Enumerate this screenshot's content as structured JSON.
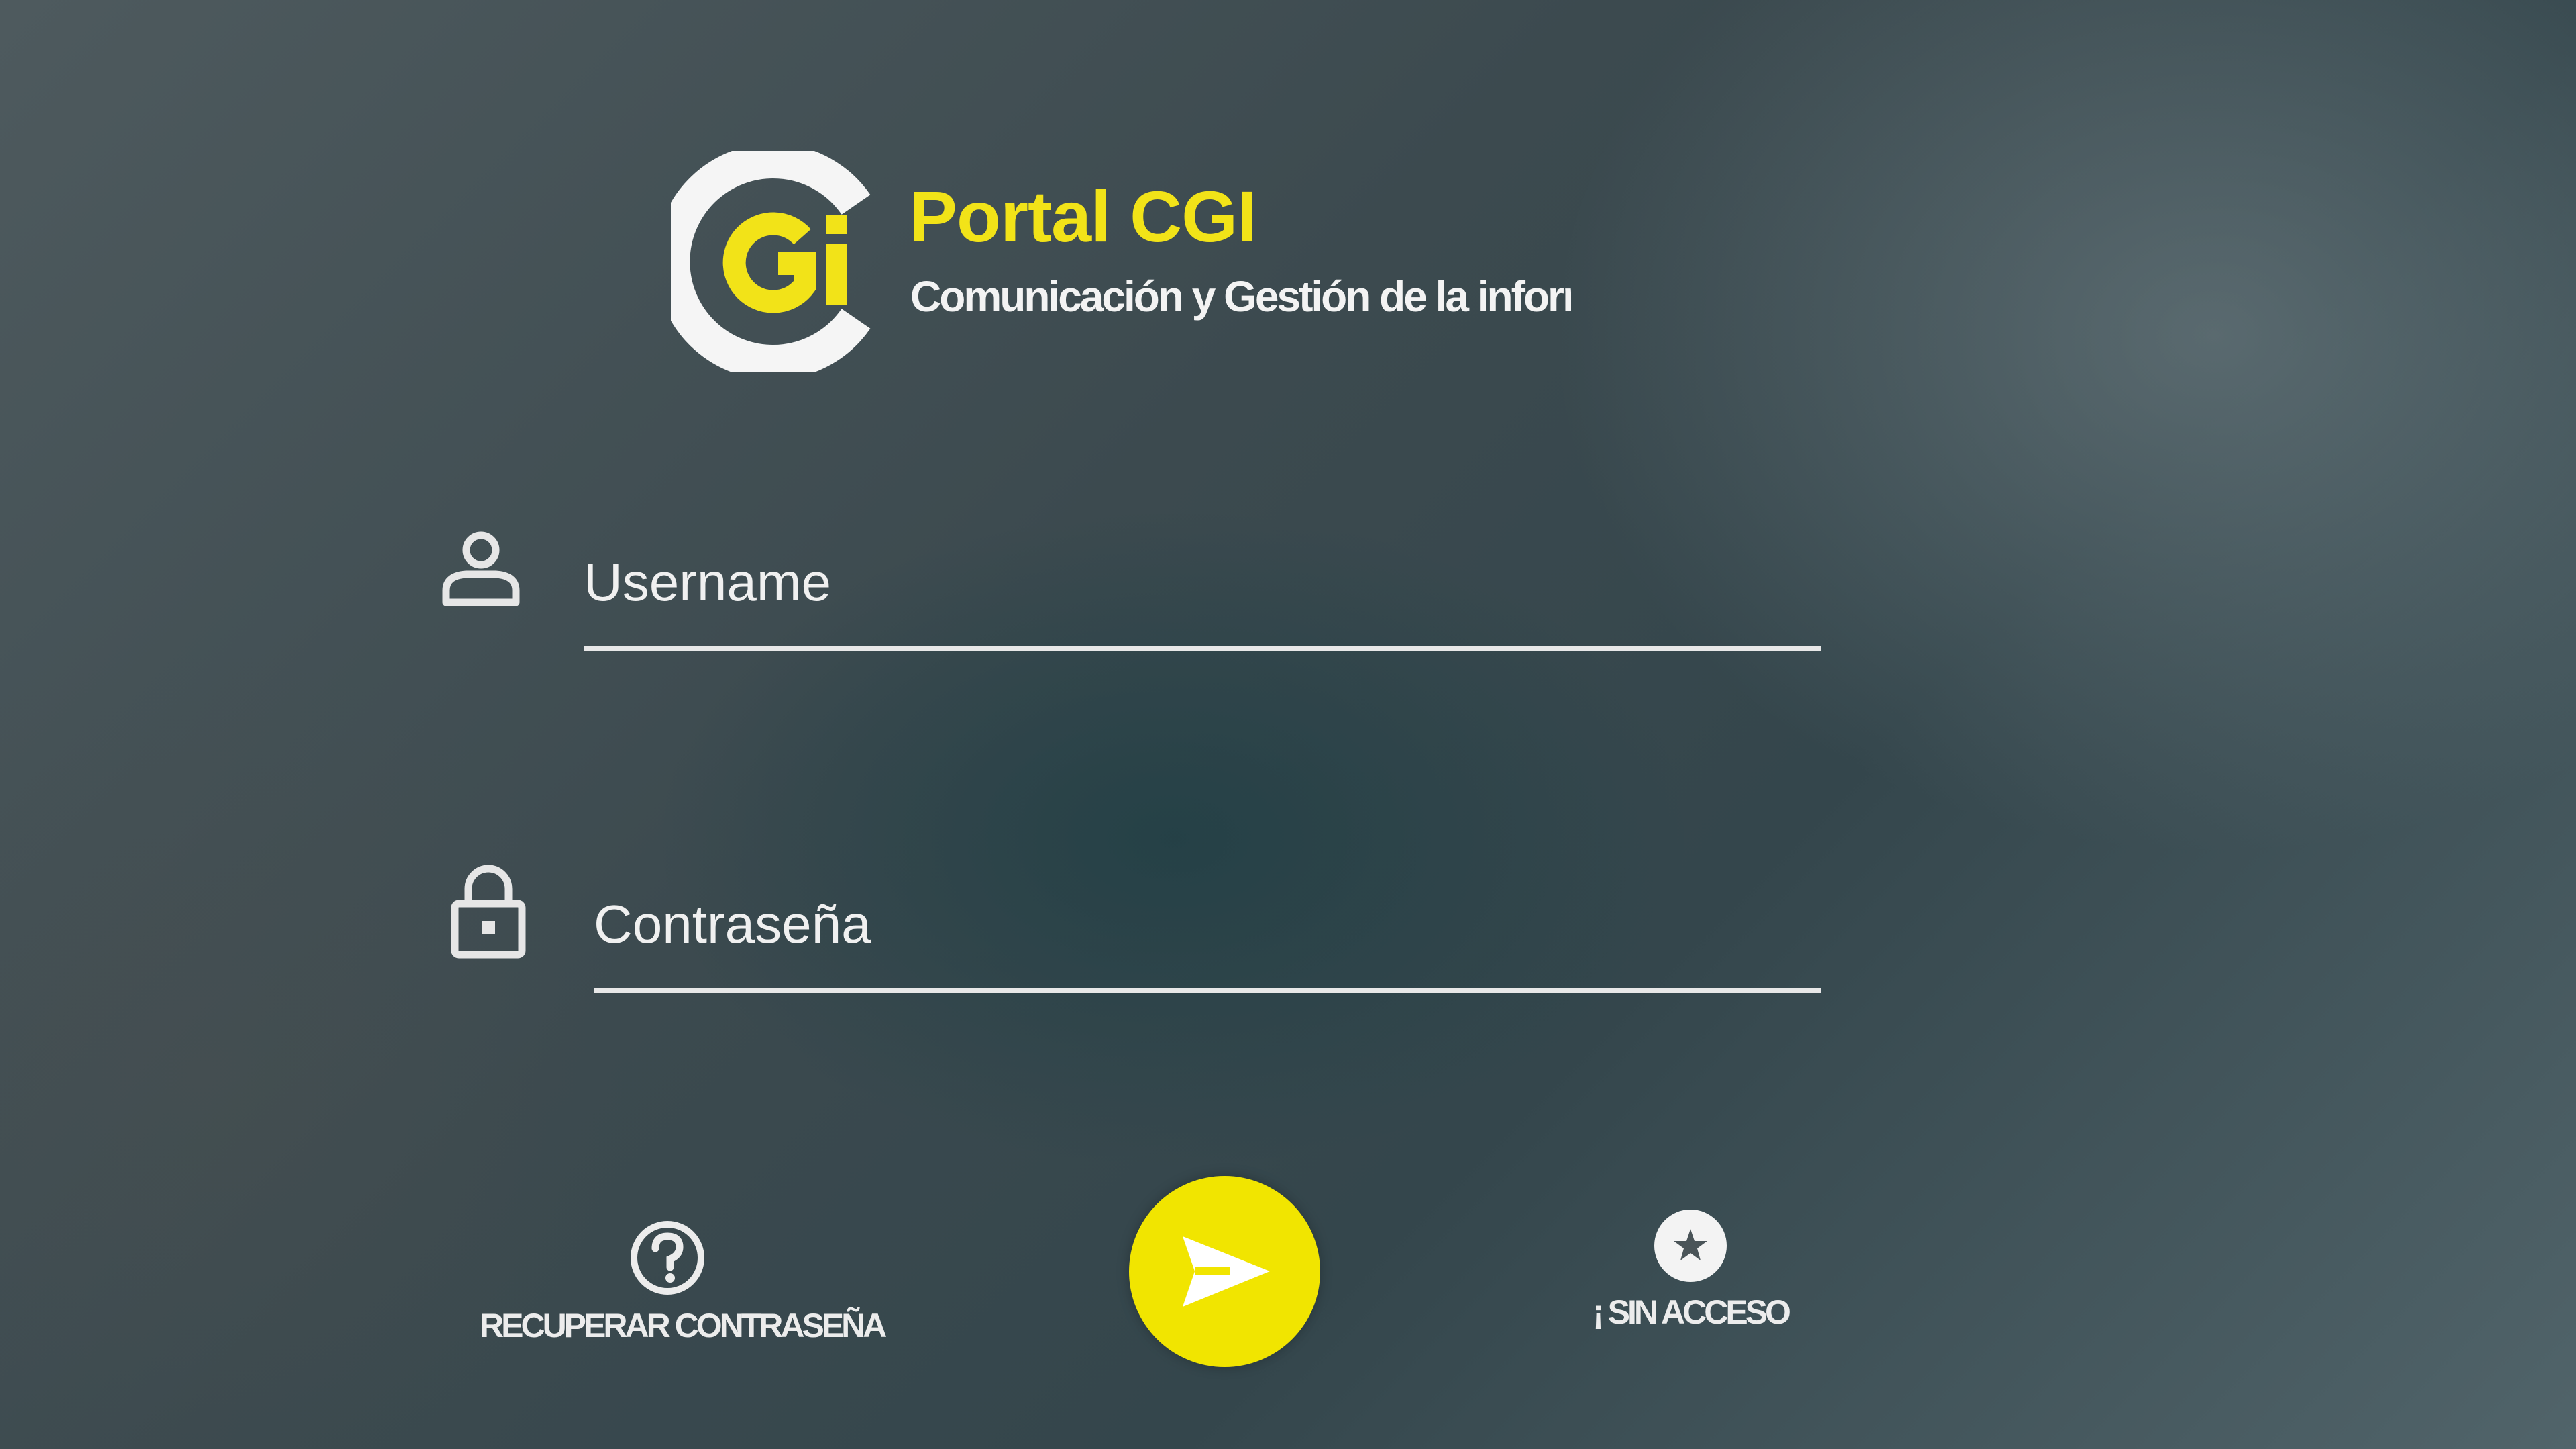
{
  "brand": {
    "title": "Portal CGI",
    "subtitle": "Comunicación y Gestión de la informació",
    "logo_text": "CGi",
    "accent_color": "#f2e318"
  },
  "form": {
    "username": {
      "placeholder": "Username",
      "value": "",
      "icon": "user-icon"
    },
    "password": {
      "placeholder": "Contraseña",
      "value": "",
      "icon": "lock-icon"
    }
  },
  "actions": {
    "recover": {
      "label": "RECUPERAR CONTRASEÑA",
      "icon": "question-circle-icon"
    },
    "submit": {
      "icon": "send-arrow-icon",
      "color": "#f1e500"
    },
    "no_access": {
      "label": "¡ SIN ACCESO",
      "icon": "star-circle-icon"
    }
  }
}
